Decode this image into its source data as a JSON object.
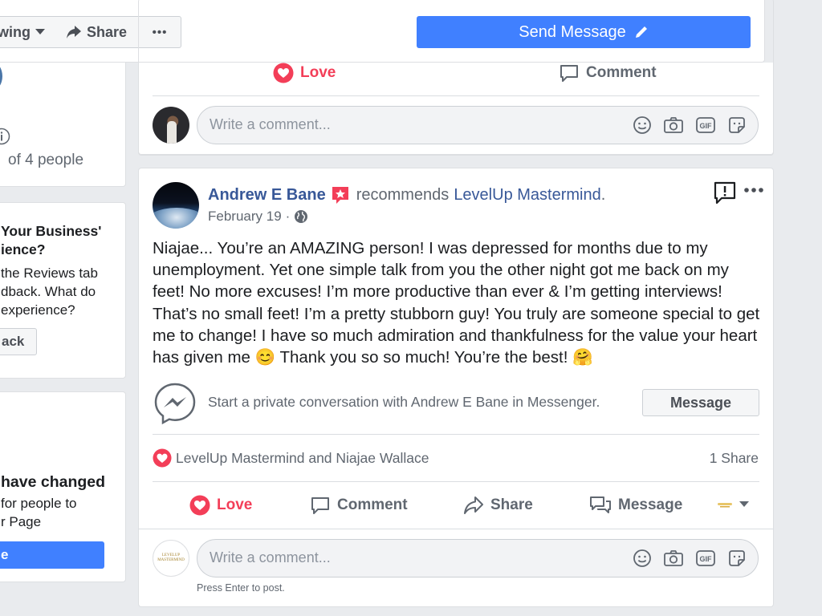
{
  "top_bar": {
    "following_label": "wing",
    "share_label": "Share",
    "more_label": "•••",
    "send_message_label": "Send Message"
  },
  "left_column": {
    "card1_text": "of 4 people",
    "card2_title_1": "Your Business'",
    "card2_title_2": "ience?",
    "card2_body_1": "the Reviews tab",
    "card2_body_2": "dback. What do",
    "card2_body_3": "experience?",
    "card2_button": "ack",
    "card3_title": "have changed",
    "card3_body_1": "for people to",
    "card3_body_2": "r Page",
    "card3_button": "e"
  },
  "prev_post": {
    "love_label": "Love",
    "comment_label": "Comment",
    "comment_placeholder": "Write a comment..."
  },
  "post": {
    "author": "Andrew E Bane",
    "recommends_text": "recommends",
    "page_name": "LevelUp Mastermind",
    "period": ".",
    "date": "February 19",
    "date_sep": "·",
    "body": "Niajae... You’re an AMAZING person! I was depressed for months due to my unemployment. Yet one simple talk from you the other night got me back on my feet! No more excuses! I’m more productive than ever & I’m getting interviews! That’s no small feet! I’m a pretty stubborn guy! You truly are someone special to get me to change! I have so much admiration and thankfulness for the value your heart has given me 😊 Thank you so so much! You’re the best! 🤗",
    "messenger_prompt": "Start a private conversation with Andrew E Bane in Messenger.",
    "message_button": "Message",
    "reactions_text": "LevelUp Mastermind and Niajae Wallace",
    "shares_text": "1 Share",
    "actions": {
      "love": "Love",
      "comment": "Comment",
      "share": "Share",
      "message": "Message"
    },
    "comment_placeholder": "Write a comment...",
    "press_enter_hint": "Press Enter to post.",
    "commenter_avatar_text": "LEVELUP MASTERMIND"
  },
  "colors": {
    "facebook_blue": "#4080ff",
    "link_blue": "#385898",
    "love_red": "#f33e58",
    "text_dark": "#1c1e21",
    "text_muted": "#606770",
    "background": "#e9ebee"
  }
}
